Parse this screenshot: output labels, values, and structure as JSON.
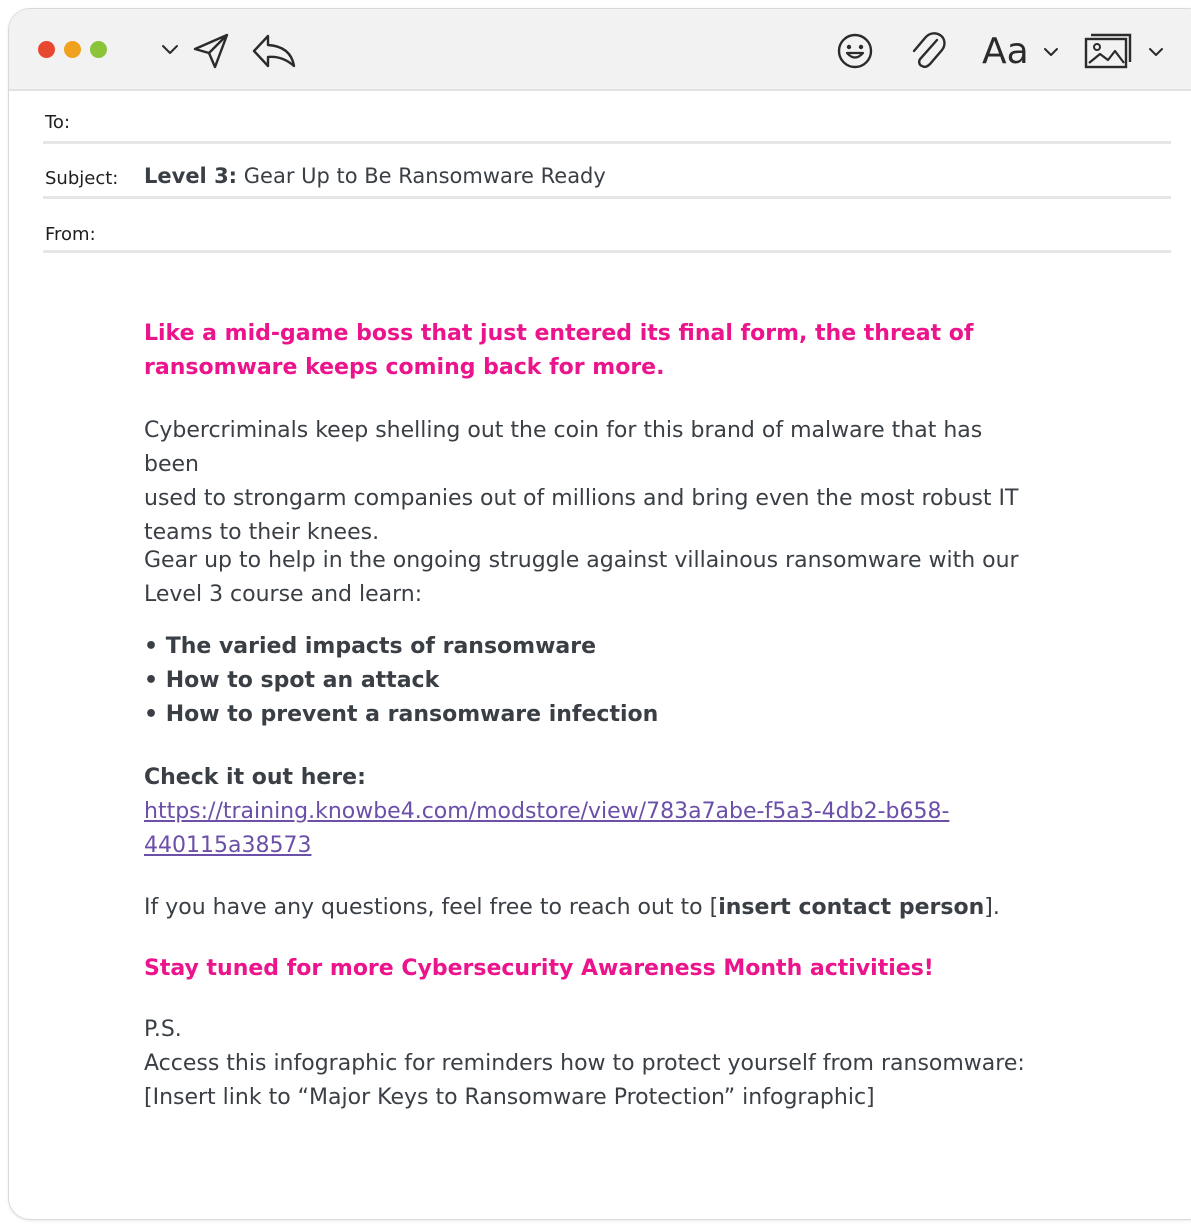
{
  "window_controls": {
    "colors": {
      "close": "#e8482f",
      "minimize": "#f0a21c",
      "maximize": "#8bc438"
    }
  },
  "toolbar": {
    "icons": [
      "chevron-down-icon",
      "send-icon",
      "reply-icon",
      "emoji-icon",
      "paperclip-icon",
      "format-text-icon",
      "chevron-down-icon",
      "image-icon",
      "chevron-down-icon"
    ],
    "format_label": "Aa"
  },
  "header": {
    "to_label": "To:",
    "subject_label": "Subject:",
    "subject_prefix": "Level 3:",
    "subject_text": " Gear Up to Be Ransomware Ready",
    "from_label": "From:"
  },
  "body": {
    "intro_line1": "Like a mid-game boss that just entered its final form, the threat of",
    "intro_line2": "ransomware keeps coming back for more.",
    "para1_line1": "Cybercriminals keep shelling out the coin for this brand of malware that has been",
    "para1_line2": "used to strongarm companies out of millions and bring even the most robust IT",
    "para1_line3": "teams to their knees.",
    "para2_line1": "Gear up to help in the ongoing struggle against villainous ransomware with our",
    "para2_line2": "Level 3 course and learn:",
    "bullets": [
      "• The varied impacts of ransomware",
      "• How to spot an attack",
      "• How to prevent a ransomware infection"
    ],
    "cta_label": "Check it out here:",
    "link_line1": "https://training.knowbe4.com/modstore/view/783a7abe-f5a3-4db2-b658-",
    "link_line2": "440115a38573",
    "questions_before": "If you have any questions, feel free to reach out to [",
    "questions_contact": "insert contact person",
    "questions_after": "].",
    "stay_tuned": "Stay tuned for more Cybersecurity Awareness Month activities!",
    "ps_label": "P.S.",
    "ps_text": "Access this infographic for reminders how to protect yourself from ransomware:",
    "ps_link": "[Insert link to “Major Keys to Ransomware Protection” infographic]"
  },
  "colors": {
    "accent_pink": "#ec148c",
    "link_purple": "#6b4fa8",
    "body_text": "#3a3f45"
  }
}
